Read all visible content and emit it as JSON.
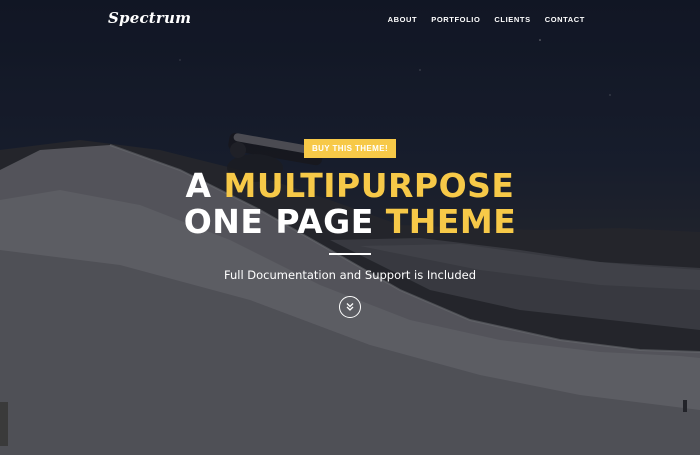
{
  "navbar": {
    "logo": "Spectrum",
    "links": [
      "ABOUT",
      "PORTFOLIO",
      "CLIENTS",
      "CONTACT"
    ]
  },
  "hero": {
    "buy_button": "BUY THIS THEME!",
    "headline_line1_white": "A ",
    "headline_line1_accent": "MULTIPURPOSE",
    "headline_line2_white": "ONE PAGE ",
    "headline_line2_accent": "THEME",
    "subtitle": "Full Documentation and Support is Included"
  },
  "icons": {
    "scroll_down": "double-chevron-down-icon"
  },
  "colors": {
    "accent": "#f7c948",
    "text": "#ffffff"
  }
}
